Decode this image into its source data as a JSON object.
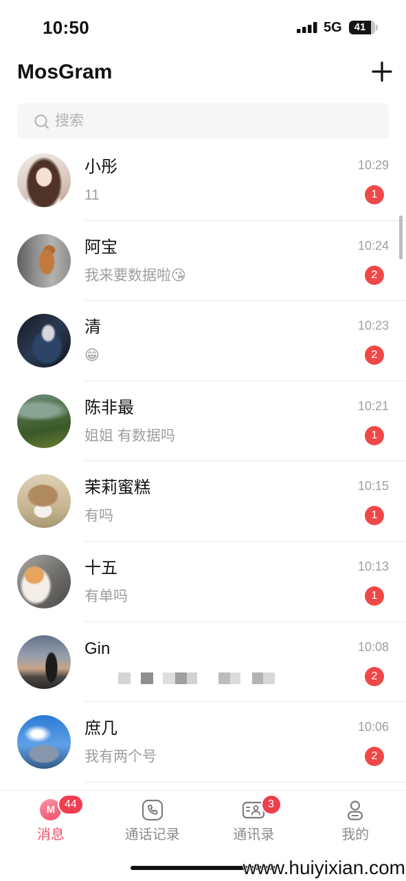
{
  "status_bar": {
    "time": "10:50",
    "network": "5G",
    "battery": "41",
    "signal_icon": "signal-bars-icon",
    "battery_icon": "battery-icon"
  },
  "header": {
    "title": "MosGram",
    "add_icon": "plus-icon"
  },
  "search": {
    "placeholder": "搜索",
    "value": "",
    "icon": "search-icon"
  },
  "chats": [
    {
      "name": "小彤",
      "preview": "11",
      "time": "10:29",
      "unread": "1"
    },
    {
      "name": "阿宝",
      "preview": "我来要数据啦😘",
      "time": "10:24",
      "unread": "2"
    },
    {
      "name": "清",
      "preview": "😁",
      "time": "10:23",
      "unread": "2"
    },
    {
      "name": "陈非最",
      "preview": "姐姐 有数据吗",
      "time": "10:21",
      "unread": "1"
    },
    {
      "name": "茉莉蜜糕",
      "preview": "有吗",
      "time": "10:15",
      "unread": "1"
    },
    {
      "name": "十五",
      "preview": "有单吗",
      "time": "10:13",
      "unread": "1"
    },
    {
      "name": "Gin",
      "preview_obscured": true,
      "time": "10:08",
      "unread": "2"
    },
    {
      "name": "庶几",
      "preview": "我有两个号",
      "time": "10:06",
      "unread": "2"
    }
  ],
  "tabs": [
    {
      "label": "消息",
      "icon": "message-icon",
      "icon_letter": "M",
      "badge": "44",
      "active": true
    },
    {
      "label": "通话记录",
      "icon": "call-log-icon",
      "active": false
    },
    {
      "label": "通讯录",
      "icon": "contacts-icon",
      "badge": "3",
      "active": false
    },
    {
      "label": "我的",
      "icon": "profile-icon",
      "active": false
    }
  ],
  "colors": {
    "accent": "#f2506a",
    "unread_badge": "#f04848",
    "text_primary": "#111111",
    "text_secondary": "#9e9e9e"
  },
  "watermark": "www.huiyixian.com"
}
